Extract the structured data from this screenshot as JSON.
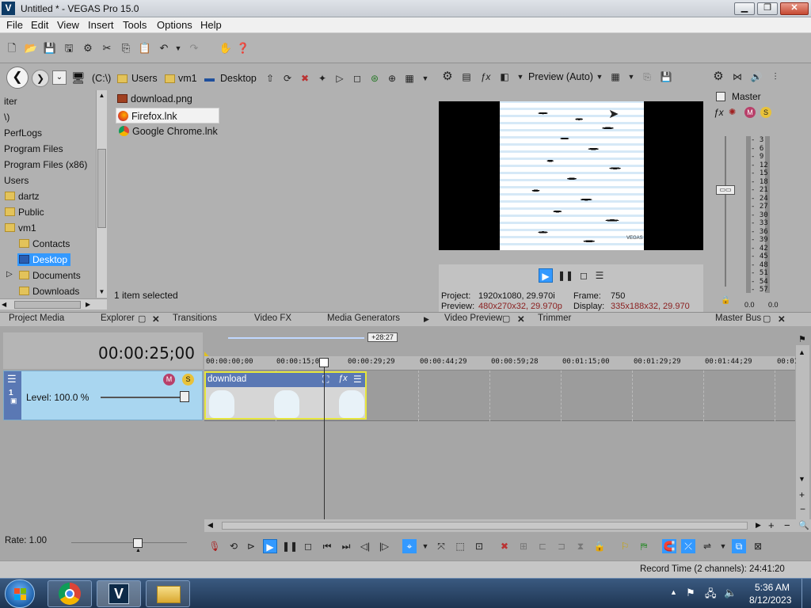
{
  "window": {
    "title": "Untitled * - VEGAS Pro 15.0",
    "logo": "V"
  },
  "menu": [
    "File",
    "Edit",
    "View",
    "Insert",
    "Tools",
    "Options",
    "Help"
  ],
  "explorer": {
    "breadcrumb": [
      "(C:\\)",
      "Users",
      "vm1",
      "Desktop"
    ],
    "tree": [
      "iter",
      "\\)",
      "PerfLogs",
      "Program Files",
      "Program Files (x86)",
      "Users",
      "dartz",
      "Public",
      "vm1",
      "Contacts",
      "Desktop",
      "Documents",
      "Downloads"
    ],
    "files": [
      "download.png",
      "Firefox.lnk",
      "Google Chrome.lnk"
    ],
    "status": "1 item selected"
  },
  "preview": {
    "quality": "Preview (Auto)",
    "project_label": "Project:",
    "project_value": "1920x1080, 29.970i",
    "frame_label": "Frame:",
    "frame_value": "750",
    "preview_label": "Preview:",
    "preview_value": "480x270x32, 29.970p",
    "display_label": "Display:",
    "display_value": "335x188x32, 29.970",
    "watermark": "VEGAS"
  },
  "master": {
    "label": "Master",
    "scale": [
      "3",
      "6",
      "9",
      "12",
      "15",
      "18",
      "21",
      "24",
      "27",
      "30",
      "33",
      "36",
      "39",
      "42",
      "45",
      "48",
      "51",
      "54",
      "57"
    ],
    "left_value": "0.0",
    "right_value": "0.0"
  },
  "tabs": {
    "left": [
      "Project Media",
      "Explorer",
      "Transitions",
      "Video FX",
      "Media Generators"
    ],
    "preview": [
      "Video Preview",
      "Trimmer"
    ],
    "master": "Master Bus"
  },
  "timeline": {
    "timecode": "00:00:25;00",
    "length_badge": "+28:27",
    "ruler": [
      "00:00:00;00",
      "00:00:15;00",
      "00:00:29;29",
      "00:00:44;29",
      "00:00:59;28",
      "00:01:15;00",
      "00:01:29;29",
      "00:01:44;29",
      "00:01"
    ],
    "track_number": "1",
    "level": "Level: 100.0 %",
    "clip_name": "download",
    "rate": "Rate: 1.00",
    "record_time": "Record Time (2 channels): 24:41:20"
  },
  "taskbar": {
    "time": "5:36 AM",
    "date": "8/12/2023"
  },
  "colors": {
    "accent": "#3399ff",
    "clip_header": "#5a78b4",
    "track_bg": "#a9d6f0",
    "clip_border": "#e6e63c"
  }
}
